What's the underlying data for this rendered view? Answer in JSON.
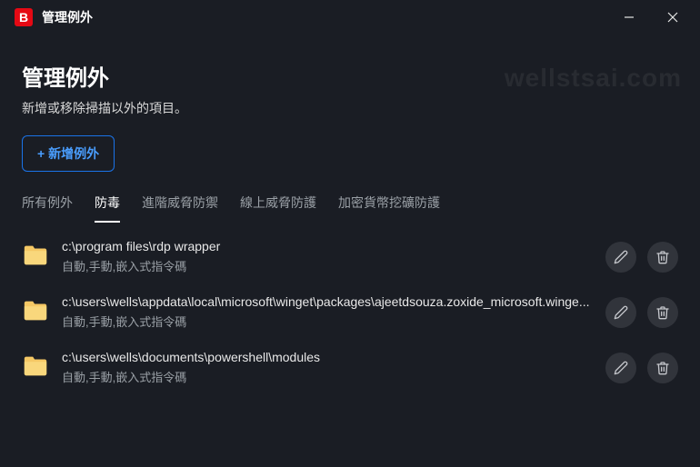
{
  "window": {
    "app_letter": "B",
    "title": "管理例外"
  },
  "header": {
    "title": "管理例外",
    "subtitle": "新增或移除掃描以外的項目。",
    "add_button": "+ 新增例外"
  },
  "tabs": [
    {
      "label": "所有例外",
      "active": false
    },
    {
      "label": "防毒",
      "active": true
    },
    {
      "label": "進階威脅防禦",
      "active": false
    },
    {
      "label": "線上威脅防護",
      "active": false
    },
    {
      "label": "加密貨幣挖礦防護",
      "active": false
    }
  ],
  "rows": [
    {
      "path": "c:\\program files\\rdp wrapper",
      "sub": "自動,手動,嵌入式指令碼"
    },
    {
      "path": "c:\\users\\wells\\appdata\\local\\microsoft\\winget\\packages\\ajeetdsouza.zoxide_microsoft.winge...",
      "sub": "自動,手動,嵌入式指令碼"
    },
    {
      "path": "c:\\users\\wells\\documents\\powershell\\modules",
      "sub": "自動,手動,嵌入式指令碼"
    }
  ],
  "watermark": "wellstsai.com"
}
